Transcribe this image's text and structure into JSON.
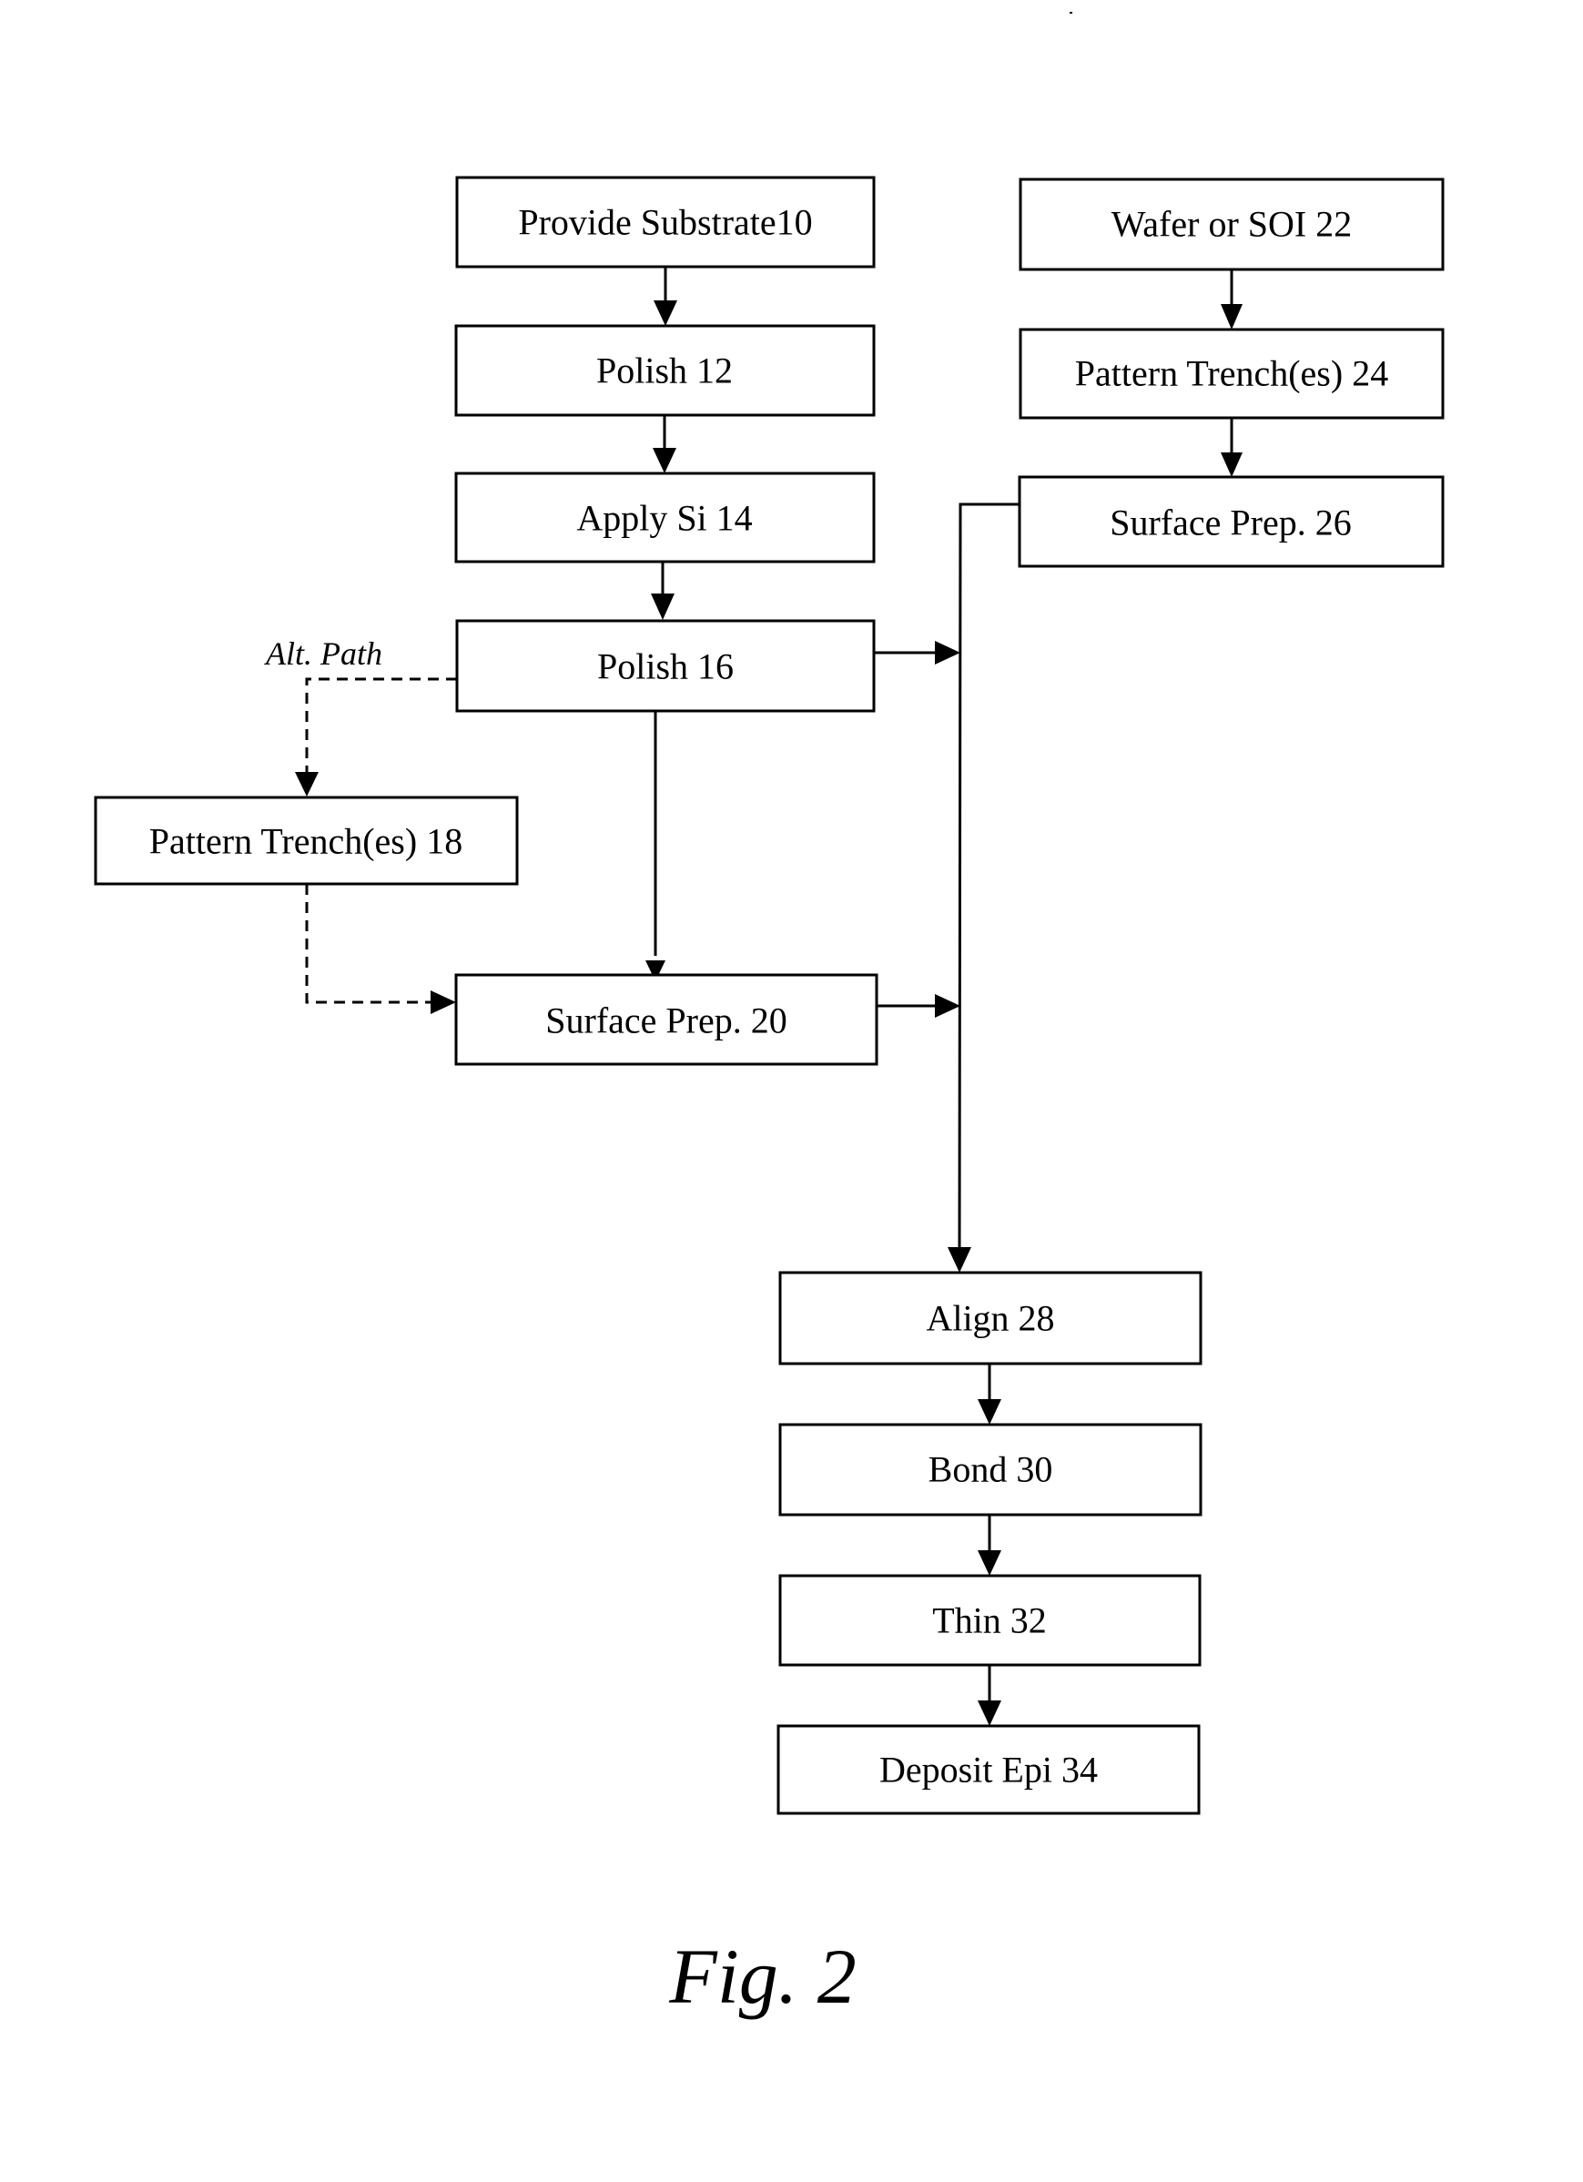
{
  "figure": {
    "caption": "Fig. 2",
    "alt_path_label": "Alt. Path"
  },
  "steps": {
    "s10": {
      "label": "Provide Substrate10",
      "ref": 10
    },
    "s12": {
      "label": "Polish 12",
      "ref": 12
    },
    "s14": {
      "label": "Apply Si 14",
      "ref": 14
    },
    "s16": {
      "label": "Polish 16",
      "ref": 16
    },
    "s18": {
      "label": "Pattern Trench(es) 18",
      "ref": 18
    },
    "s20": {
      "label": "Surface Prep. 20",
      "ref": 20
    },
    "s22": {
      "label": "Wafer or SOI 22",
      "ref": 22
    },
    "s24": {
      "label": "Pattern Trench(es) 24",
      "ref": 24
    },
    "s26": {
      "label": "Surface Prep. 26",
      "ref": 26
    },
    "s28": {
      "label": "Align 28",
      "ref": 28
    },
    "s30": {
      "label": "Bond 30",
      "ref": 30
    },
    "s32": {
      "label": "Thin 32",
      "ref": 32
    },
    "s34": {
      "label": "Deposit Epi 34",
      "ref": 34
    }
  },
  "edges": [
    {
      "from": "s10",
      "to": "s12",
      "style": "solid"
    },
    {
      "from": "s12",
      "to": "s14",
      "style": "solid"
    },
    {
      "from": "s14",
      "to": "s16",
      "style": "solid"
    },
    {
      "from": "s16",
      "to": "s18",
      "style": "dashed",
      "label": "Alt. Path"
    },
    {
      "from": "s18",
      "to": "s20",
      "style": "dashed"
    },
    {
      "from": "s16",
      "to": "s20",
      "style": "solid"
    },
    {
      "from": "s16",
      "to": "bus",
      "style": "solid"
    },
    {
      "from": "s20",
      "to": "bus",
      "style": "solid"
    },
    {
      "from": "s22",
      "to": "s24",
      "style": "solid"
    },
    {
      "from": "s24",
      "to": "s26",
      "style": "solid"
    },
    {
      "from": "s26",
      "to": "bus",
      "style": "solid"
    },
    {
      "from": "bus",
      "to": "s28",
      "style": "solid"
    },
    {
      "from": "s28",
      "to": "s30",
      "style": "solid"
    },
    {
      "from": "s30",
      "to": "s32",
      "style": "solid"
    },
    {
      "from": "s32",
      "to": "s34",
      "style": "solid"
    }
  ]
}
